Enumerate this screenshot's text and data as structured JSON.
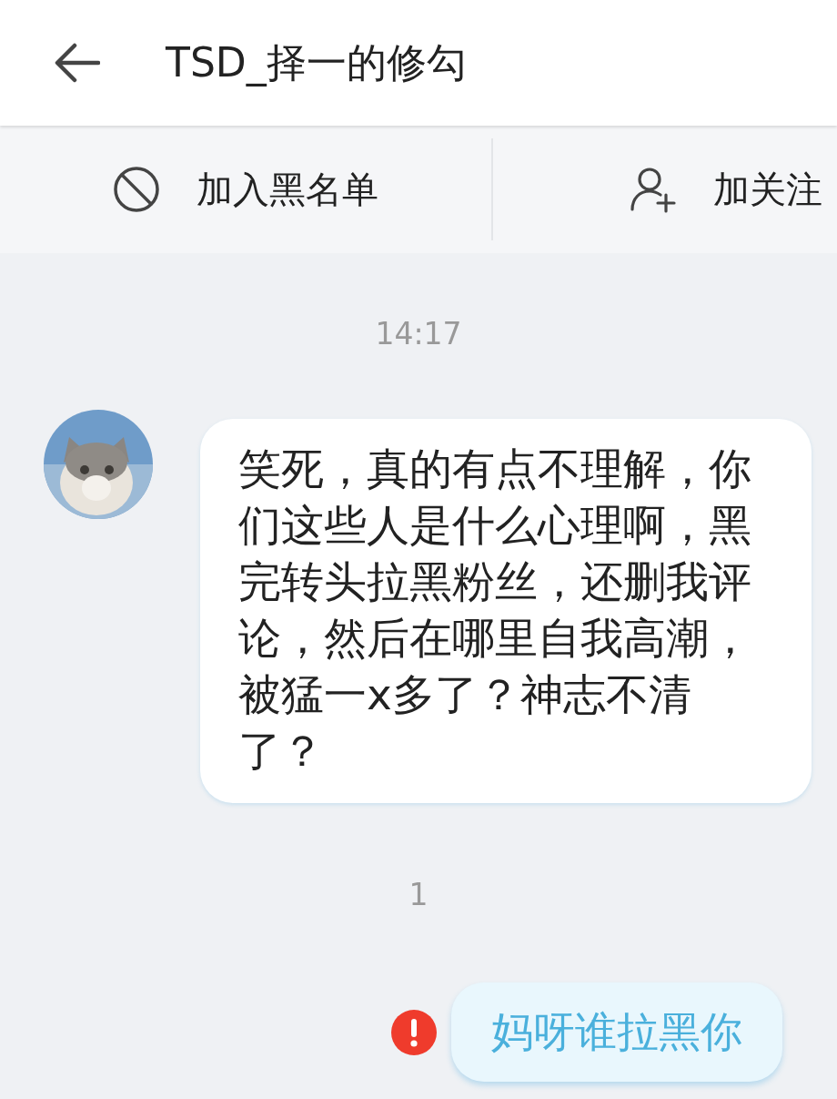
{
  "header": {
    "title": "TSD_择一的修勾"
  },
  "actions": [
    {
      "kind": "block",
      "label": "加入黑名单"
    },
    {
      "kind": "follow",
      "label": "加关注"
    }
  ],
  "messages": [
    {
      "kind": "time",
      "text": "14:17"
    },
    {
      "kind": "incoming",
      "text": "笑死，真的有点不理解，你们这些人是什么心理啊，黑完转头拉黑粉丝，还删我评论，然后在哪里自我高潮，被猛一x多了？神志不清了？"
    },
    {
      "kind": "time",
      "text": "1"
    },
    {
      "kind": "outgoing",
      "failed": true,
      "text": "妈呀谁拉黑你"
    }
  ]
}
